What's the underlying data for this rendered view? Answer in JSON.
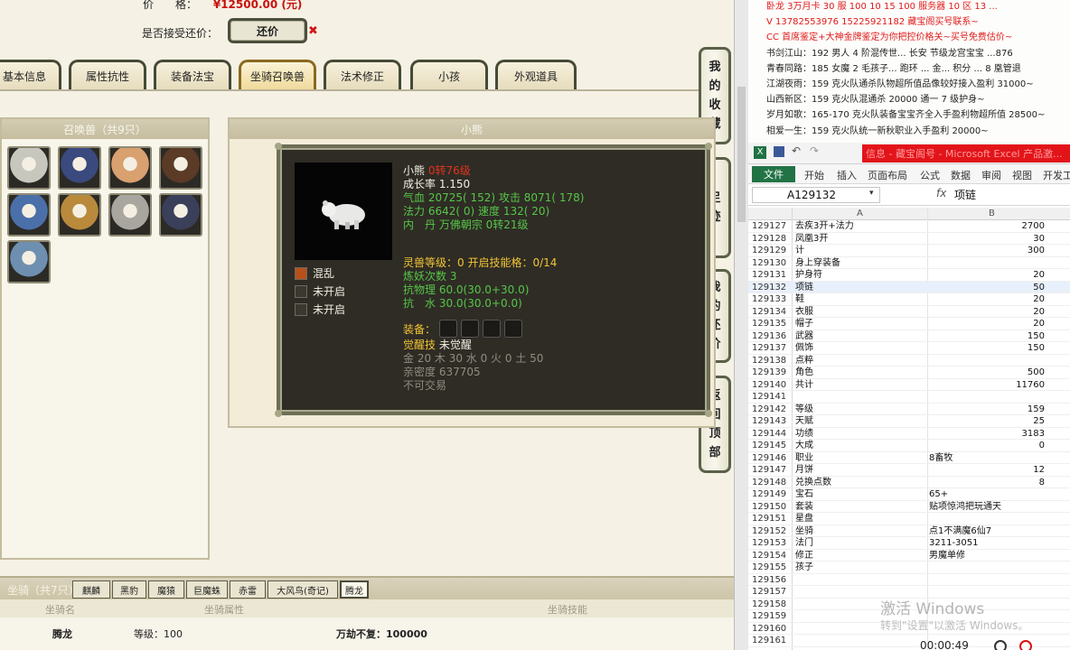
{
  "trade": {
    "price_label": "价　　格：",
    "price_value": "¥12500.00 (元)",
    "accept_counter_label": "是否接受还价：",
    "counter_button": "还价",
    "counter_close": "✖"
  },
  "tabs": [
    "基本信息",
    "属性抗性",
    "装备法宝",
    "坐骑召唤兽",
    "法术修正",
    "小孩",
    "外观道具"
  ],
  "active_tab": "坐骑召唤兽",
  "side_buttons": [
    [
      "我",
      "的",
      "收",
      "藏"
    ],
    [
      "足",
      "迹"
    ],
    [
      "我",
      "的",
      "还",
      "价"
    ],
    [
      "返",
      "回",
      "顶",
      "部"
    ]
  ],
  "pets": {
    "header": "召唤兽（共9只）",
    "icons": [
      "white-bear-pet",
      "phoenix-pet",
      "lion-cub-pet",
      "monkey-warrior-pet",
      "ice-spirit-pet",
      "golden-beast-pet",
      "white-ape-pet",
      "blue-warrior-pet",
      "blue-golem-pet"
    ],
    "colors": [
      "#c8c7bd",
      "#3a4a7e",
      "#d9a070",
      "#5b3a26",
      "#4b6fa8",
      "#b98a3c",
      "#a9a6a0",
      "#3a3f5a",
      "#6e8fb0"
    ]
  },
  "detail": {
    "header": "小熊",
    "name": "小熊",
    "level_tag": "0转76级",
    "growth": "成长率 1.150",
    "hp_label": "气血",
    "hp": "20725( 152)",
    "atk_label": "攻击",
    "atk": "8071( 178)",
    "mp_label": "法力",
    "mp": "6642( 0)",
    "spd_label": "速度",
    "spd": "132( 20)",
    "neidan": "内　丹 万佛朝宗 0转21级",
    "spirit_level": "灵兽等级：0 开启技能格：0/14",
    "refine_count": "炼妖次数 3",
    "res_phys": "抗物理  60.0(30.0+30.0)",
    "res_water": "抗　水  30.0(30.0+0.0)",
    "equip_label": "装备：",
    "awaken_label": "觉醒技",
    "awaken_value": "未觉醒",
    "elements": "金 20 木 30 水 0 火 0 土 50",
    "intimacy": "亲密度 637705",
    "tradeable": "不可交易",
    "skills": [
      "混乱",
      "未开启",
      "未开启"
    ]
  },
  "mounts": {
    "title": "坐骑（共7只）",
    "tabs": [
      "麒麟",
      "黑豹",
      "魔猿",
      "巨魔蛛",
      "赤雷",
      "大风鸟(奇记)",
      "腾龙"
    ],
    "active": "腾龙",
    "head_name": "坐骑名",
    "head_attr": "坐骑属性",
    "head_skill": "坐骑技能",
    "row_name": "腾龙",
    "row_level": "等级：100",
    "row_skill": "万劫不复：100000"
  },
  "stream": {
    "lines": [
      {
        "text": "卧龙 3万月卡 30 服 100 10 15 100 服务器 10 区 13 ...",
        "red": true
      },
      {
        "text": "V 13782553976    15225921182   藏宝阁买号联系~",
        "red": true
      },
      {
        "text": "CC 首席鉴定+大神金牌鉴定为你把控价格关~买号免费估价~",
        "red": true
      },
      {
        "text": "书剑江山：192 男人 4 阶混传世... 长安 节级龙宫宝宝 ...876",
        "red": false
      },
      {
        "text": "青春同路：185 女魔 2 毛孩子... 跑环 ... 金... 积分 ... 8 凰管退",
        "red": false
      },
      {
        "text": "江湖夜雨：159 克火队通杀队物超所值品像较好接入盈利 31000~",
        "red": false
      },
      {
        "text": "山西新区：159 克火队混通杀 20000 通一 7 级护身~",
        "red": false
      },
      {
        "text": "岁月如歌：165-170 克火队装备宝宝齐全入手盈利物超所值 28500~",
        "red": false
      },
      {
        "text": "相爱一生：159 克火队统一新秋职业入手盈利 20000~",
        "red": false
      }
    ]
  },
  "excel": {
    "title": "信息 - 藏宝阁号 - Microsoft Excel 产品激...",
    "file_tab": "文件",
    "ribbon": [
      "开始",
      "插入",
      "页面布局",
      "公式",
      "数据",
      "审阅",
      "视图",
      "开发工"
    ],
    "name_box": "A129132",
    "fx": "fx",
    "formula": "项链",
    "col_a": "A",
    "col_b": "B",
    "rows": [
      {
        "n": "129127",
        "a": "去疾3开+法力",
        "b": "2700",
        "r": true
      },
      {
        "n": "129128",
        "a": "凤凰3开",
        "b": "30",
        "r": true
      },
      {
        "n": "129129",
        "a": "计",
        "b": "300",
        "r": true
      },
      {
        "n": "129130",
        "a": "身上穿装备",
        "b": "",
        "r": true
      },
      {
        "n": "129131",
        "a": "护身符",
        "b": "20",
        "r": true
      },
      {
        "n": "129132",
        "a": "项链",
        "b": "50",
        "r": true
      },
      {
        "n": "129133",
        "a": "鞋",
        "b": "20",
        "r": true
      },
      {
        "n": "129134",
        "a": "衣服",
        "b": "20",
        "r": true
      },
      {
        "n": "129135",
        "a": "帽子",
        "b": "20",
        "r": true
      },
      {
        "n": "129136",
        "a": "武器",
        "b": "150",
        "r": true
      },
      {
        "n": "129137",
        "a": "佩饰",
        "b": "150",
        "r": true
      },
      {
        "n": "129138",
        "a": "点粹",
        "b": "",
        "r": true
      },
      {
        "n": "129139",
        "a": "角色",
        "b": "500",
        "r": true
      },
      {
        "n": "129140",
        "a": "共计",
        "b": "11760",
        "r": true
      },
      {
        "n": "129141",
        "a": "",
        "b": "",
        "r": true
      },
      {
        "n": "129142",
        "a": "等级",
        "b": "159",
        "r": true
      },
      {
        "n": "129143",
        "a": "天赋",
        "b": "25",
        "r": true
      },
      {
        "n": "129144",
        "a": "功绩",
        "b": "3183",
        "r": true
      },
      {
        "n": "129145",
        "a": "大成",
        "b": "0",
        "r": true
      },
      {
        "n": "129146",
        "a": "职业",
        "b": "8畜牧",
        "r": false
      },
      {
        "n": "129147",
        "a": "月饼",
        "b": "12",
        "r": true
      },
      {
        "n": "129148",
        "a": "兑换点数",
        "b": "8",
        "r": true
      },
      {
        "n": "129149",
        "a": "宝石",
        "b": "65+",
        "r": false
      },
      {
        "n": "129150",
        "a": "套装",
        "b": "贴项惊鸿把玩通天",
        "r": false
      },
      {
        "n": "129151",
        "a": "星盘",
        "b": "",
        "r": false
      },
      {
        "n": "129152",
        "a": "坐骑",
        "b": "点1不满魔6仙7",
        "r": false
      },
      {
        "n": "129153",
        "a": "法门",
        "b": "3211-3051",
        "r": false
      },
      {
        "n": "129154",
        "a": "修正",
        "b": "男魔单修",
        "r": false
      },
      {
        "n": "129155",
        "a": "孩子",
        "b": "",
        "r": false
      },
      {
        "n": "129156",
        "a": "",
        "b": "",
        "r": false
      },
      {
        "n": "129157",
        "a": "",
        "b": "",
        "r": false
      },
      {
        "n": "129158",
        "a": "",
        "b": "",
        "r": false
      },
      {
        "n": "129159",
        "a": "",
        "b": "",
        "r": false
      },
      {
        "n": "129160",
        "a": "",
        "b": "",
        "r": false
      },
      {
        "n": "129161",
        "a": "",
        "b": "",
        "r": false
      }
    ]
  },
  "watermark": {
    "line1": "激活 Windows",
    "line2": "转到\"设置\"以激活 Windows。"
  },
  "recorder": {
    "time": "00:00:49"
  }
}
